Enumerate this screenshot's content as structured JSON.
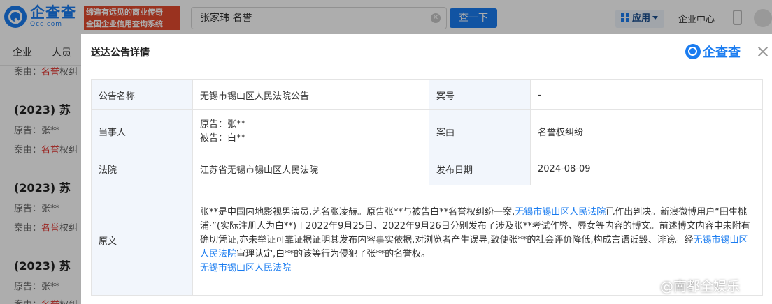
{
  "header": {
    "logo_cn": "企查查",
    "logo_en": "Qcc.com",
    "slogan_line1": "缔造有远见的商业传奇",
    "slogan_line2": "全国企业信用查询系统",
    "search_value": "张家玮 名誉",
    "search_button": "查一下",
    "apps_label": "应用",
    "enterprise_center": "企业中心"
  },
  "subnav": {
    "items": [
      "企业",
      "人员"
    ]
  },
  "background_list": {
    "case_prefix": "(2023) 苏",
    "plaintiff": "原告：张**",
    "cause_label": "案由：",
    "cause_value": "名誉",
    "cause_tail": "权纠"
  },
  "modal": {
    "title": "送达公告详情",
    "logo_text": "企查查",
    "rows": {
      "notice_name_label": "公告名称",
      "notice_name_value": "无锡市锡山区人民法院公告",
      "case_no_label": "案号",
      "case_no_value": "-",
      "party_label": "当事人",
      "plaintiff": "原告：张**",
      "defendant": "被告：白**",
      "cause_label": "案由",
      "cause_value": "名誉权纠纷",
      "court_label": "法院",
      "court_value": "江苏省无锡市锡山区人民法院",
      "publish_date_label": "发布日期",
      "publish_date_value": "2024-08-09",
      "original_label": "原文",
      "original_p1": "张**是中国内地影视男演员,艺名张凌赫。原告张**与被告白**名誉权纠纷一案,",
      "original_court_link1": "无锡市锡山区人民法院",
      "original_p2": "已作出判决。新浪微博用户“田生桃浦·”(实际注册人为白**)于2022年9月25日、2022年9月26日分别发布了涉及张**考试作弊、辱女等内容的博文。前述博文内容中未附有确切凭证,亦未举证可靠证据证明其发布内容事实依据,对浏览者产生误导,致使张**的社会评价降低,构成言语诋毁、诽谤。经",
      "original_court_link2": "无锡市锡山区人民法院",
      "original_p3": "审理认定,白**的该等行为侵犯了张**的名誉权。",
      "original_signature": "无锡市锡山区人民法院"
    }
  },
  "watermark": "@南都全娱乐"
}
